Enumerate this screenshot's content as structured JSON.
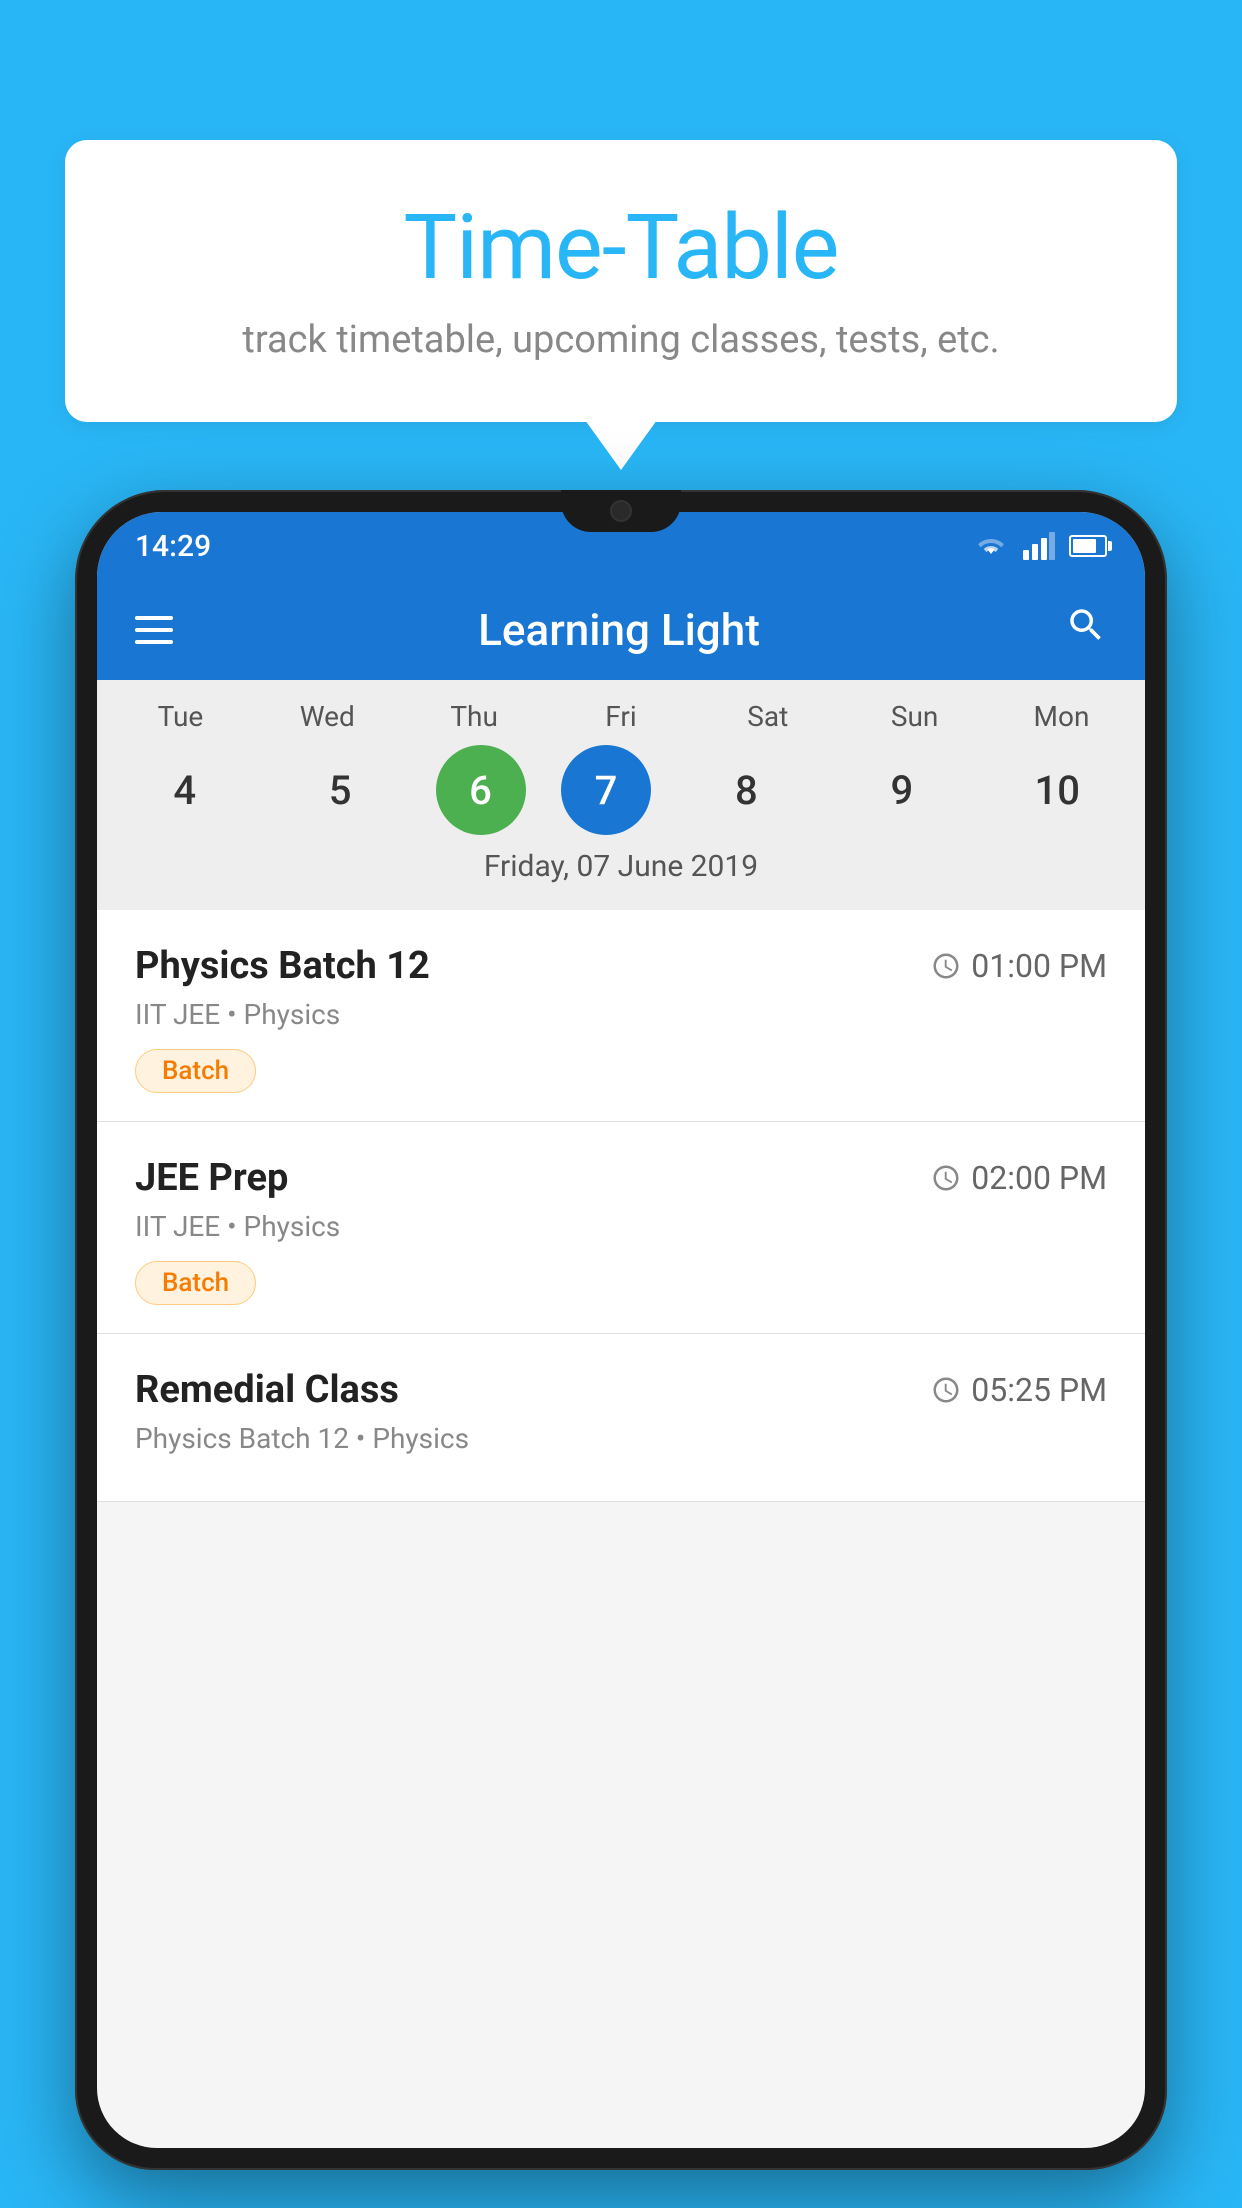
{
  "background_color": "#29B6F6",
  "speech_bubble": {
    "title": "Time-Table",
    "subtitle": "track timetable, upcoming classes, tests, etc."
  },
  "status_bar": {
    "time": "14:29"
  },
  "app_bar": {
    "title": "Learning Light"
  },
  "calendar": {
    "selected_date_label": "Friday, 07 June 2019",
    "days": [
      {
        "name": "Tue",
        "number": "4",
        "state": "normal"
      },
      {
        "name": "Wed",
        "number": "5",
        "state": "normal"
      },
      {
        "name": "Thu",
        "number": "6",
        "state": "today"
      },
      {
        "name": "Fri",
        "number": "7",
        "state": "selected"
      },
      {
        "name": "Sat",
        "number": "8",
        "state": "normal"
      },
      {
        "name": "Sun",
        "number": "9",
        "state": "normal"
      },
      {
        "name": "Mon",
        "number": "10",
        "state": "normal"
      }
    ]
  },
  "schedule": [
    {
      "title": "Physics Batch 12",
      "time": "01:00 PM",
      "meta": "IIT JEE • Physics",
      "badge": "Batch"
    },
    {
      "title": "JEE Prep",
      "time": "02:00 PM",
      "meta": "IIT JEE • Physics",
      "badge": "Batch"
    },
    {
      "title": "Remedial Class",
      "time": "05:25 PM",
      "meta": "Physics Batch 12 • Physics",
      "badge": ""
    }
  ]
}
